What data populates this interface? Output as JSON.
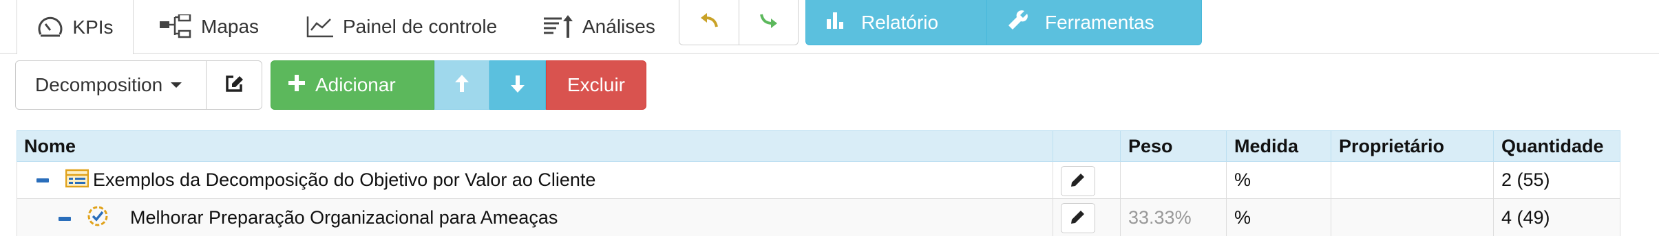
{
  "tabs": [
    {
      "label": "KPIs",
      "icon": "gauge-icon",
      "active": true
    },
    {
      "label": "Mapas",
      "icon": "sitemap-icon",
      "active": false
    },
    {
      "label": "Painel de controle",
      "icon": "line-chart-icon",
      "active": false
    },
    {
      "label": "Análises",
      "icon": "sort-analysis-icon",
      "active": false
    }
  ],
  "history": {
    "undo_icon": "undo-icon",
    "redo_icon": "redo-icon",
    "undo_color": "#c9a227",
    "redo_color": "#5cb85c"
  },
  "menus": {
    "relatorio": {
      "label": "Relatório",
      "icon": "bar-chart-icon"
    },
    "ferramentas": {
      "label": "Ferramentas",
      "icon": "wrench-icon"
    },
    "color": "#5bc0de"
  },
  "toolbar": {
    "view_select": "Decomposition",
    "add_label": "Adicionar",
    "delete_label": "Excluir",
    "colors": {
      "add": "#5cb85c",
      "up": "#9fd8ec",
      "down": "#5bc0de",
      "delete": "#d9534f"
    }
  },
  "table": {
    "columns": [
      "Nome",
      "",
      "Peso",
      "Medida",
      "Proprietário",
      "Quantidade"
    ],
    "header_bg": "#d9edf7",
    "rows": [
      {
        "name": "Exemplos da Decomposição do Objetivo por Valor ao Cliente",
        "icon": "scorecard-icon",
        "peso": "",
        "medida": "%",
        "proprietario": "",
        "quantidade": "2 (55)",
        "level": 0
      },
      {
        "name": "Melhorar Preparação Organizacional para Ameaças",
        "icon": "objective-check-icon",
        "peso": "33.33%",
        "medida": "%",
        "proprietario": "",
        "quantidade": "4 (49)",
        "level": 1
      }
    ]
  }
}
